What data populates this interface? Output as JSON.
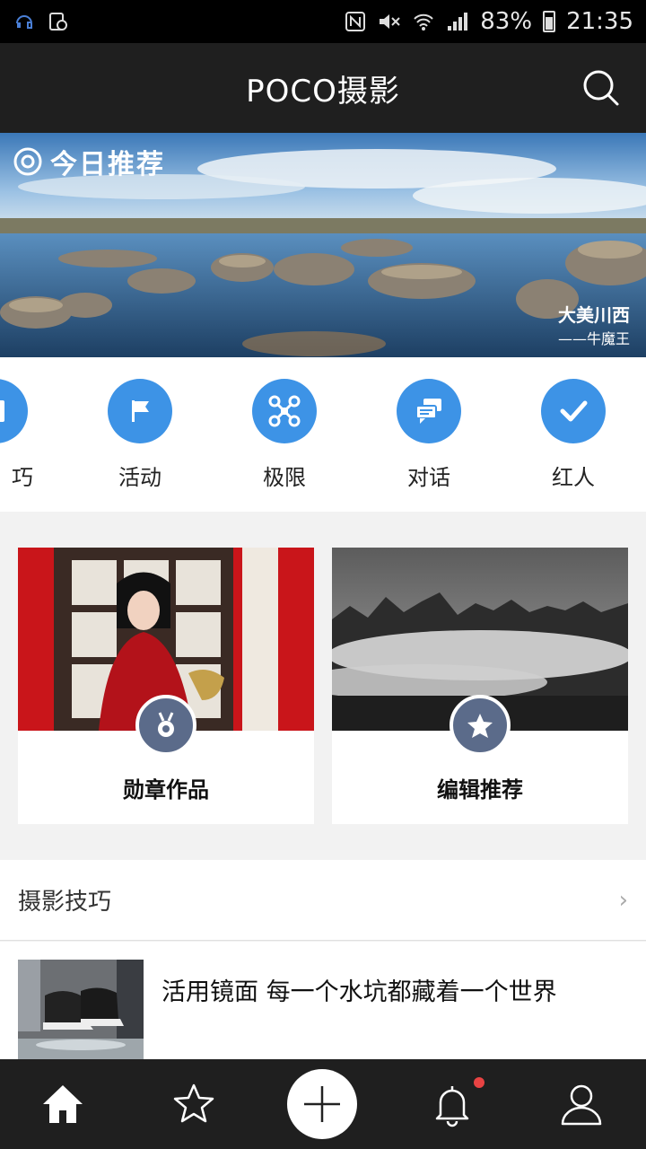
{
  "status_bar": {
    "battery": "83%",
    "time": "21:35"
  },
  "header": {
    "title": "POCO摄影"
  },
  "banner": {
    "logo_text": "今日推荐",
    "caption_title": "大美川西",
    "caption_author": "——牛魔王"
  },
  "categories": [
    {
      "label": "巧",
      "icon": "book-icon"
    },
    {
      "label": "活动",
      "icon": "flag-icon"
    },
    {
      "label": "极限",
      "icon": "drone-icon"
    },
    {
      "label": "对话",
      "icon": "chat-icon"
    },
    {
      "label": "红人",
      "icon": "check-icon"
    }
  ],
  "cards": [
    {
      "label": "勋章作品",
      "badge_icon": "medal-icon"
    },
    {
      "label": "编辑推荐",
      "badge_icon": "star-icon"
    }
  ],
  "tips": {
    "title": "摄影技巧",
    "articles": [
      {
        "title": "活用镜面 每一个水坑都藏着一个世界"
      }
    ]
  },
  "bottom_nav": [
    {
      "name": "home",
      "icon": "home-icon"
    },
    {
      "name": "favorites",
      "icon": "star-icon"
    },
    {
      "name": "add",
      "icon": "plus-icon"
    },
    {
      "name": "notifications",
      "icon": "bell-icon"
    },
    {
      "name": "profile",
      "icon": "user-icon"
    }
  ],
  "colors": {
    "accent": "#3d93e6",
    "header_bg": "#1f1f1f",
    "badge": "#5b6b8a",
    "notif": "#e84343"
  }
}
